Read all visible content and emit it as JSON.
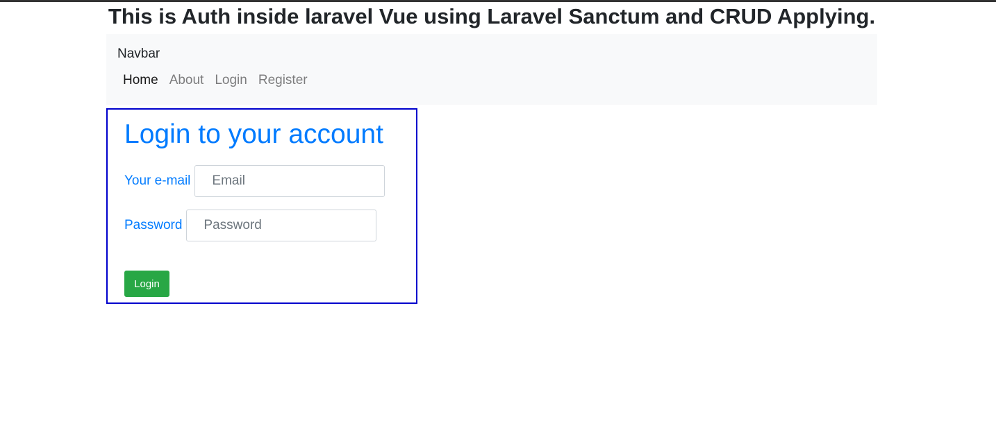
{
  "page": {
    "heading": "This is Auth inside laravel Vue using Laravel Sanctum and CRUD Applying."
  },
  "navbar": {
    "brand": "Navbar",
    "links": [
      {
        "label": "Home",
        "active": true
      },
      {
        "label": "About",
        "active": false
      },
      {
        "label": "Login",
        "active": false
      },
      {
        "label": "Register",
        "active": false
      }
    ]
  },
  "login_form": {
    "title": "Login to your account",
    "email_label": "Your e-mail",
    "email_placeholder": "Email",
    "email_value": "",
    "password_label": "Password",
    "password_placeholder": "Password",
    "password_value": "",
    "submit_label": "Login"
  },
  "colors": {
    "primary": "#007bff",
    "success": "#28a745",
    "form_border": "#0000cc",
    "navbar_bg": "#f8f9fa"
  }
}
